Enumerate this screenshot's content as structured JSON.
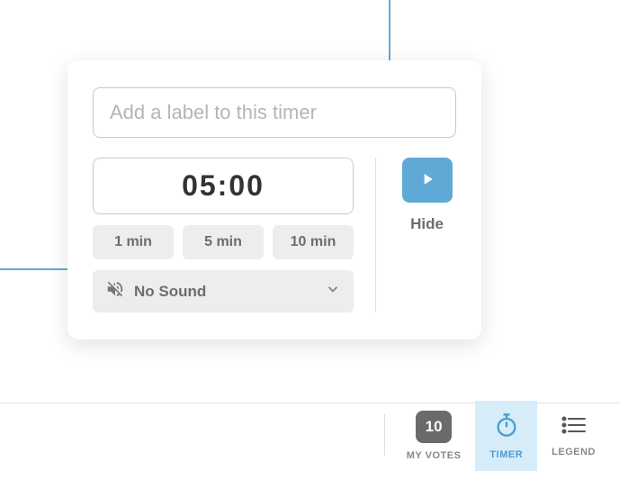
{
  "timer": {
    "label_placeholder": "Add a label to this timer",
    "time_value": "05:00",
    "presets": {
      "one_min": "1 min",
      "five_min": "5 min",
      "ten_min": "10 min"
    },
    "sound_label": "No Sound",
    "hide_label": "Hide"
  },
  "toolbar": {
    "votes": {
      "count": "10",
      "label": "MY VOTES"
    },
    "timer_label": "TIMER",
    "legend_label": "LEGEND"
  }
}
